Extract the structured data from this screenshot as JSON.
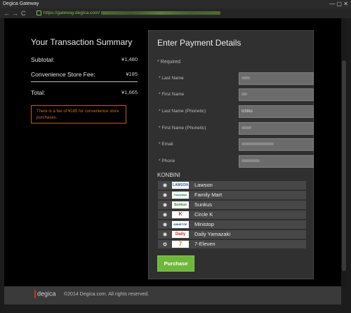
{
  "window": {
    "title": "Degica Gateway",
    "controls": "— ▢ ✕"
  },
  "browser": {
    "back": "←",
    "forward": "→",
    "reload": "C",
    "url": "https://gateway.degica.com/"
  },
  "summary": {
    "title": "Your Transaction Summary",
    "subtotal_label": "Subtotal:",
    "subtotal_value": "¥1,480",
    "fee_label": "Convenience Store Fee:",
    "fee_value": "¥185",
    "total_label": "Total:",
    "total_value": "¥1,665",
    "note": "There is a fee of ¥185 for convenience store purchases."
  },
  "payment": {
    "title": "Enter Payment Details",
    "required": "* Required",
    "fields": [
      {
        "label": "* Last Name",
        "value": ""
      },
      {
        "label": "* First Name",
        "value": ""
      },
      {
        "label": "* Last Name (Phonetic)",
        "value": "Ichiko"
      },
      {
        "label": "* First Name (Phonetic)",
        "value": ""
      },
      {
        "label": "* Email",
        "value": ""
      },
      {
        "label": "* Phone",
        "value": ""
      }
    ],
    "konbini_title": "KONBINI",
    "stores": [
      {
        "name": "Lawson",
        "logo": "LAWSON",
        "logo_color": "#1e5fb4"
      },
      {
        "name": "Family Mart",
        "logo": "FamilyMart",
        "logo_color": "#0b8a3c"
      },
      {
        "name": "Sunkus",
        "logo": "Sunkus",
        "logo_color": "#2a8a2a"
      },
      {
        "name": "Circle K",
        "logo": "K",
        "logo_color": "#d42a1e"
      },
      {
        "name": "Ministop",
        "logo": "MINISTOP",
        "logo_color": "#1a3f9c"
      },
      {
        "name": "Daily Yamazaki",
        "logo": "Daily",
        "logo_color": "#d42a1e"
      },
      {
        "name": "7-Eleven",
        "logo": "7",
        "logo_color": "#e8731b"
      }
    ],
    "selected_store": "7-Eleven",
    "purchase_label": "Purchase"
  },
  "footer": {
    "logo": "degica",
    "copyright": "©2014 Degica.com. All rights reserved."
  }
}
